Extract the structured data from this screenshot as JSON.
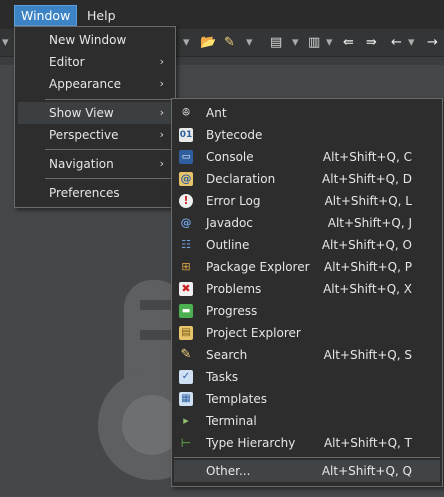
{
  "menubar": {
    "window_label": "Window",
    "help_label": "Help"
  },
  "window_menu": {
    "new_window": "New Window",
    "editor": "Editor",
    "appearance": "Appearance",
    "show_view": "Show View",
    "perspective": "Perspective",
    "navigation": "Navigation",
    "preferences": "Preferences",
    "submenu_arrow": "›"
  },
  "show_view_menu": {
    "items": [
      {
        "label": "Ant",
        "shortcut": "",
        "icon": "ant-icon"
      },
      {
        "label": "Bytecode",
        "shortcut": "",
        "icon": "bytecode-icon"
      },
      {
        "label": "Console",
        "shortcut": "Alt+Shift+Q, C",
        "icon": "console-icon"
      },
      {
        "label": "Declaration",
        "shortcut": "Alt+Shift+Q, D",
        "icon": "declaration-icon"
      },
      {
        "label": "Error Log",
        "shortcut": "Alt+Shift+Q, L",
        "icon": "error-log-icon"
      },
      {
        "label": "Javadoc",
        "shortcut": "Alt+Shift+Q, J",
        "icon": "javadoc-icon"
      },
      {
        "label": "Outline",
        "shortcut": "Alt+Shift+Q, O",
        "icon": "outline-icon"
      },
      {
        "label": "Package Explorer",
        "shortcut": "Alt+Shift+Q, P",
        "icon": "package-explorer-icon"
      },
      {
        "label": "Problems",
        "shortcut": "Alt+Shift+Q, X",
        "icon": "problems-icon"
      },
      {
        "label": "Progress",
        "shortcut": "",
        "icon": "progress-icon"
      },
      {
        "label": "Project Explorer",
        "shortcut": "",
        "icon": "project-explorer-icon"
      },
      {
        "label": "Search",
        "shortcut": "Alt+Shift+Q, S",
        "icon": "search-icon"
      },
      {
        "label": "Tasks",
        "shortcut": "",
        "icon": "tasks-icon"
      },
      {
        "label": "Templates",
        "shortcut": "",
        "icon": "templates-icon"
      },
      {
        "label": "Terminal",
        "shortcut": "",
        "icon": "terminal-icon"
      },
      {
        "label": "Type Hierarchy",
        "shortcut": "Alt+Shift+Q, T",
        "icon": "type-hierarchy-icon"
      },
      {
        "label": "Other...",
        "shortcut": "Alt+Shift+Q, Q",
        "icon": ""
      }
    ]
  },
  "colors": {
    "menu_bg": "#2d2d2d",
    "selection": "#3d84c6",
    "background": "#45484b"
  }
}
